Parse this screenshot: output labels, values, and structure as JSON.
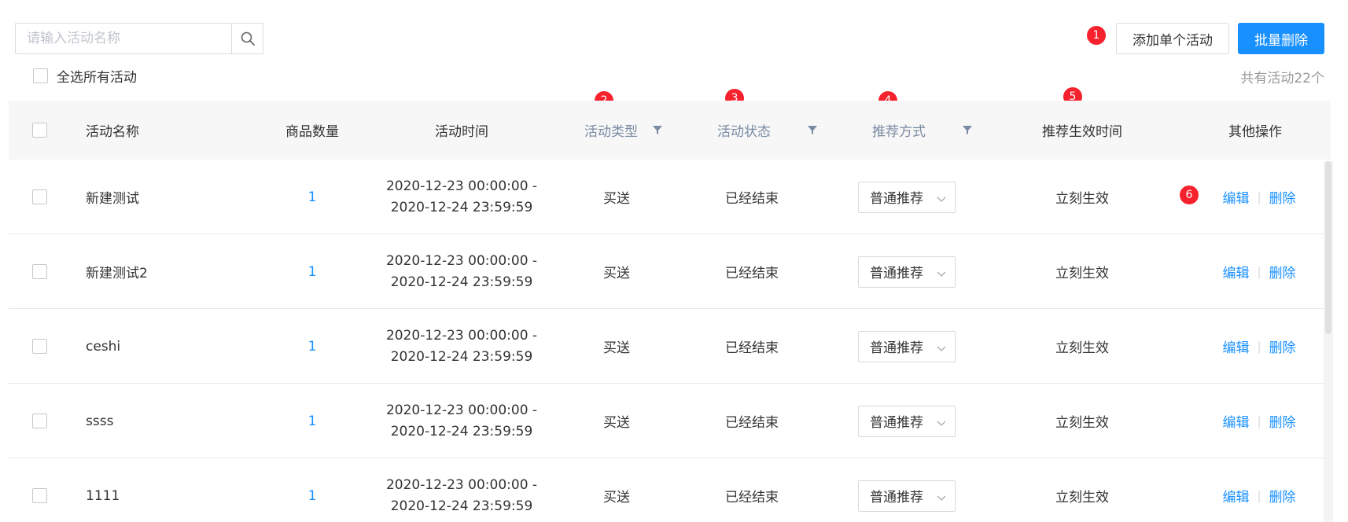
{
  "search": {
    "placeholder": "请输入活动名称",
    "value": ""
  },
  "select_all_label": "全选所有活动",
  "buttons": {
    "add_single": "添加单个活动",
    "batch_delete": "批量删除"
  },
  "total_text": "共有活动22个",
  "badges": [
    "1",
    "2",
    "3",
    "4",
    "5",
    "6"
  ],
  "columns": {
    "name": "活动名称",
    "qty": "商品数量",
    "time": "活动时间",
    "type": "活动类型",
    "status": "活动状态",
    "recommend": "推荐方式",
    "effect_time": "推荐生效时间",
    "ops": "其他操作"
  },
  "rows": [
    {
      "name": "新建测试",
      "qty": "1",
      "time_start": "2020-12-23 00:00:00 -",
      "time_end": "2020-12-24 23:59:59",
      "type": "买送",
      "status": "已经结束",
      "recommend": "普通推荐",
      "effect": "立刻生效",
      "edit": "编辑",
      "delete": "删除"
    },
    {
      "name": "新建测试2",
      "qty": "1",
      "time_start": "2020-12-23 00:00:00 -",
      "time_end": "2020-12-24 23:59:59",
      "type": "买送",
      "status": "已经结束",
      "recommend": "普通推荐",
      "effect": "立刻生效",
      "edit": "编辑",
      "delete": "删除"
    },
    {
      "name": "ceshi",
      "qty": "1",
      "time_start": "2020-12-23 00:00:00 -",
      "time_end": "2020-12-24 23:59:59",
      "type": "买送",
      "status": "已经结束",
      "recommend": "普通推荐",
      "effect": "立刻生效",
      "edit": "编辑",
      "delete": "删除"
    },
    {
      "name": "ssss",
      "qty": "1",
      "time_start": "2020-12-23 00:00:00 -",
      "time_end": "2020-12-24 23:59:59",
      "type": "买送",
      "status": "已经结束",
      "recommend": "普通推荐",
      "effect": "立刻生效",
      "edit": "编辑",
      "delete": "删除"
    },
    {
      "name": "1111",
      "qty": "1",
      "time_start": "2020-12-23 00:00:00 -",
      "time_end": "2020-12-24 23:59:59",
      "type": "买送",
      "status": "已经结束",
      "recommend": "普通推荐",
      "effect": "立刻生效",
      "edit": "编辑",
      "delete": "删除"
    }
  ],
  "colors": {
    "primary": "#1890ff",
    "badge": "#f5222d",
    "header_bg": "#f7f7f7",
    "filter_header": "#7a8ba3"
  }
}
